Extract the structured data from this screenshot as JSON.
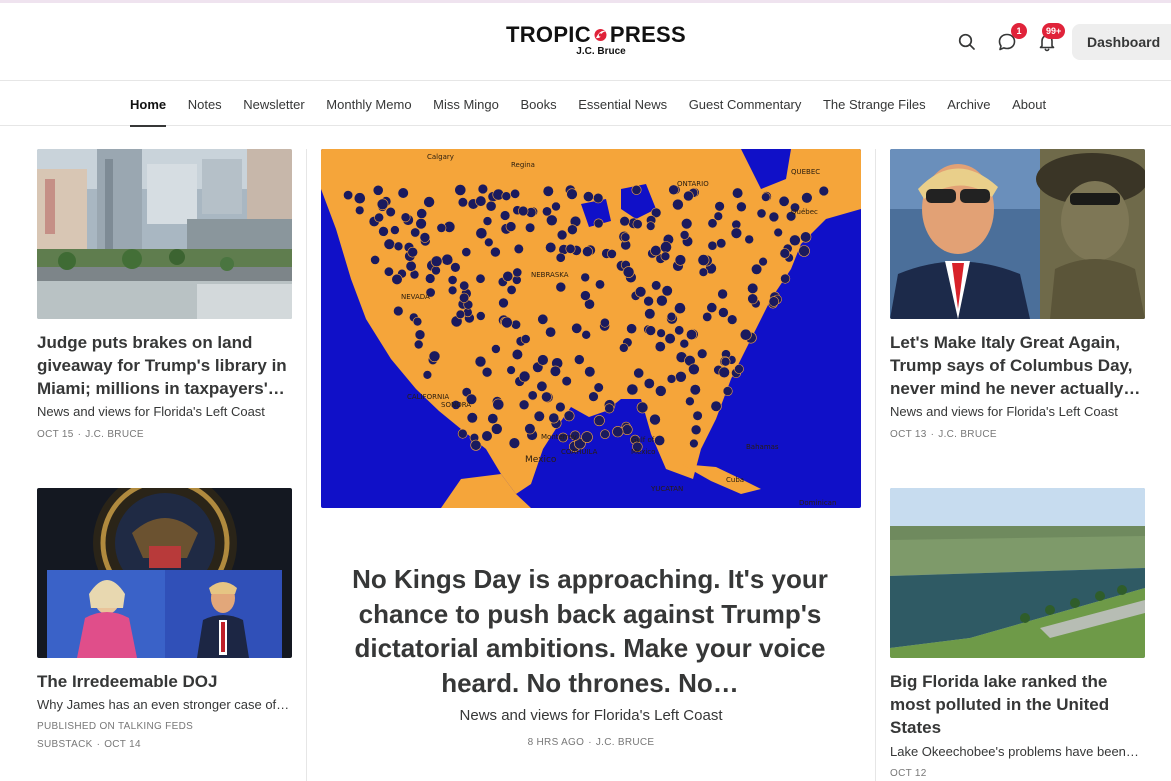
{
  "header": {
    "logo_main_left": "TROPIC",
    "logo_main_right": "PRESS",
    "logo_sub": "J.C. Bruce",
    "messages_badge": "1",
    "notifications_badge": "99+",
    "dashboard_label": "Dashboard",
    "icons": [
      "search-icon",
      "chat-bubble-icon",
      "bell-icon"
    ]
  },
  "nav": {
    "items": [
      {
        "label": "Home",
        "active": true
      },
      {
        "label": "Notes"
      },
      {
        "label": "Newsletter"
      },
      {
        "label": "Monthly Memo"
      },
      {
        "label": "Miss Mingo"
      },
      {
        "label": "Books"
      },
      {
        "label": "Essential News"
      },
      {
        "label": "Guest Commentary"
      },
      {
        "label": "The Strange Files"
      },
      {
        "label": "Archive"
      },
      {
        "label": "About"
      }
    ]
  },
  "posts": {
    "left1": {
      "title": "Judge puts brakes on land giveaway for Trump's library in Miami; millions in taxpayers'…",
      "subtitle": "News and views for Florida's Left Coast",
      "date": "OCT 15",
      "author": "J.C. BRUCE"
    },
    "left2": {
      "title": "The Irredeemable DOJ",
      "subtitle": "Why James has an even stronger case of…",
      "published_on": "PUBLISHED ON TALKING FEDS",
      "meta_line2_prefix": "SUBSTACK",
      "date": "OCT 14"
    },
    "hero": {
      "title": "No Kings Day is approaching. It's your chance to push back against Trump's dictatorial ambitions. Make your voice heard. No thrones. No…",
      "subtitle": "News and views for Florida's Left Coast",
      "date": "8 HRS AGO",
      "author": "J.C. BRUCE",
      "map_labels": [
        "Calgary",
        "Regina",
        "ONTARIO",
        "QUEBEC",
        "Québec",
        "NEVADA",
        "NEBRASKA",
        "CALIFORNIA",
        "SONORA",
        "COAHUILA",
        "Monterrey",
        "Gulf of",
        "Mexico",
        "Mexico",
        "Cuba",
        "Bahamas",
        "YUCATAN",
        "Dominican"
      ]
    },
    "right1": {
      "title": "Let's Make Italy Great Again, Trump says of Columbus Day, never mind he never actually…",
      "subtitle": "News and views for Florida's Left Coast",
      "date": "OCT 13",
      "author": "J.C. BRUCE"
    },
    "right2": {
      "title": "Big Florida lake ranked the most polluted in the United States",
      "subtitle": "Lake Okeechobee's problems have been…",
      "date": "OCT 12"
    }
  },
  "colors": {
    "accent_red": "#e0233a",
    "map_ocean": "#1010c8",
    "map_land": "#f5a53a",
    "map_dot": "#1a1a5e",
    "text": "#363737"
  }
}
